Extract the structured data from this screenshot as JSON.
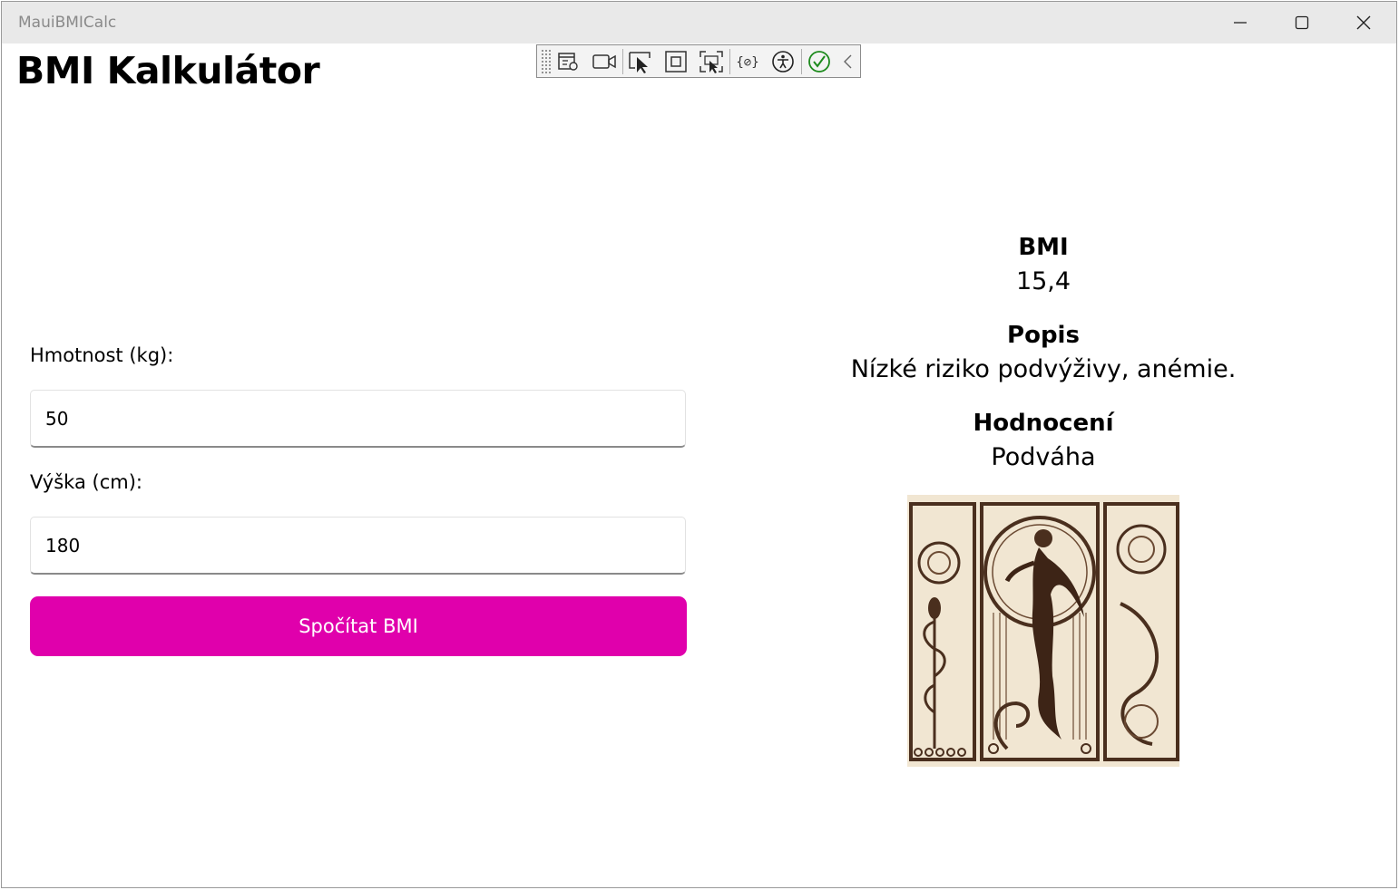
{
  "window": {
    "title": "MauiBMICalc"
  },
  "page": {
    "title": "BMI Kalkulátor"
  },
  "form": {
    "weight_label": "Hmotnost (kg):",
    "weight_value": "50",
    "height_label": "Výška (cm):",
    "height_value": "180",
    "calculate_label": "Spočítat BMI"
  },
  "results": {
    "bmi_heading": "BMI",
    "bmi_value": "15,4",
    "description_heading": "Popis",
    "description_value": "Nízké riziko podvýživy, anémie.",
    "rating_heading": "Hodnocení",
    "rating_value": "Podváha"
  },
  "colors": {
    "accent": "#e000ac",
    "titlebar": "#e9e9e9"
  },
  "devtoolbar": {
    "icons": [
      "live-visual-tree-icon",
      "record-icon",
      "select-element-icon",
      "display-layout-adorners-icon",
      "track-focused-element-icon",
      "binding-failures-icon",
      "accessibility-icon",
      "check-icon",
      "collapse-chevron-icon"
    ]
  }
}
